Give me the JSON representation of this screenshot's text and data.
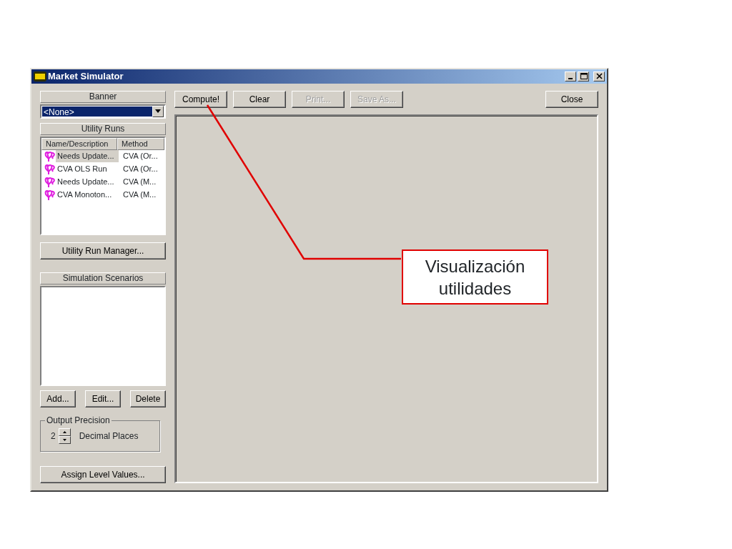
{
  "window": {
    "title": "Market Simulator"
  },
  "banner": {
    "heading": "Banner",
    "value": "<None>"
  },
  "utility_runs": {
    "heading": "Utility Runs",
    "columns": [
      "Name/Description",
      "Method"
    ],
    "rows": [
      {
        "name": "Needs Update...",
        "method": "CVA (Or...",
        "selected": true
      },
      {
        "name": "CVA OLS Run",
        "method": "CVA (Or...",
        "selected": false
      },
      {
        "name": "Needs Update...",
        "method": "CVA (M...",
        "selected": false
      },
      {
        "name": "CVA Monoton...",
        "method": "CVA (M...",
        "selected": false
      }
    ],
    "manager_button": "Utility Run Manager..."
  },
  "simulation_scenarios": {
    "heading": "Simulation Scenarios",
    "buttons": [
      "Add...",
      "Edit...",
      "Delete"
    ]
  },
  "output_precision": {
    "title": "Output Precision",
    "value": "2",
    "units": "Decimal Places"
  },
  "assign_button": "Assign Level Values...",
  "toolbar": [
    {
      "label": "Compute!",
      "disabled": false
    },
    {
      "label": "Clear",
      "disabled": false
    },
    {
      "label": "Print...",
      "disabled": true
    },
    {
      "label": "Save As...",
      "disabled": true
    }
  ],
  "close_button": "Close",
  "callout": {
    "text": "Visualización utilidades"
  }
}
